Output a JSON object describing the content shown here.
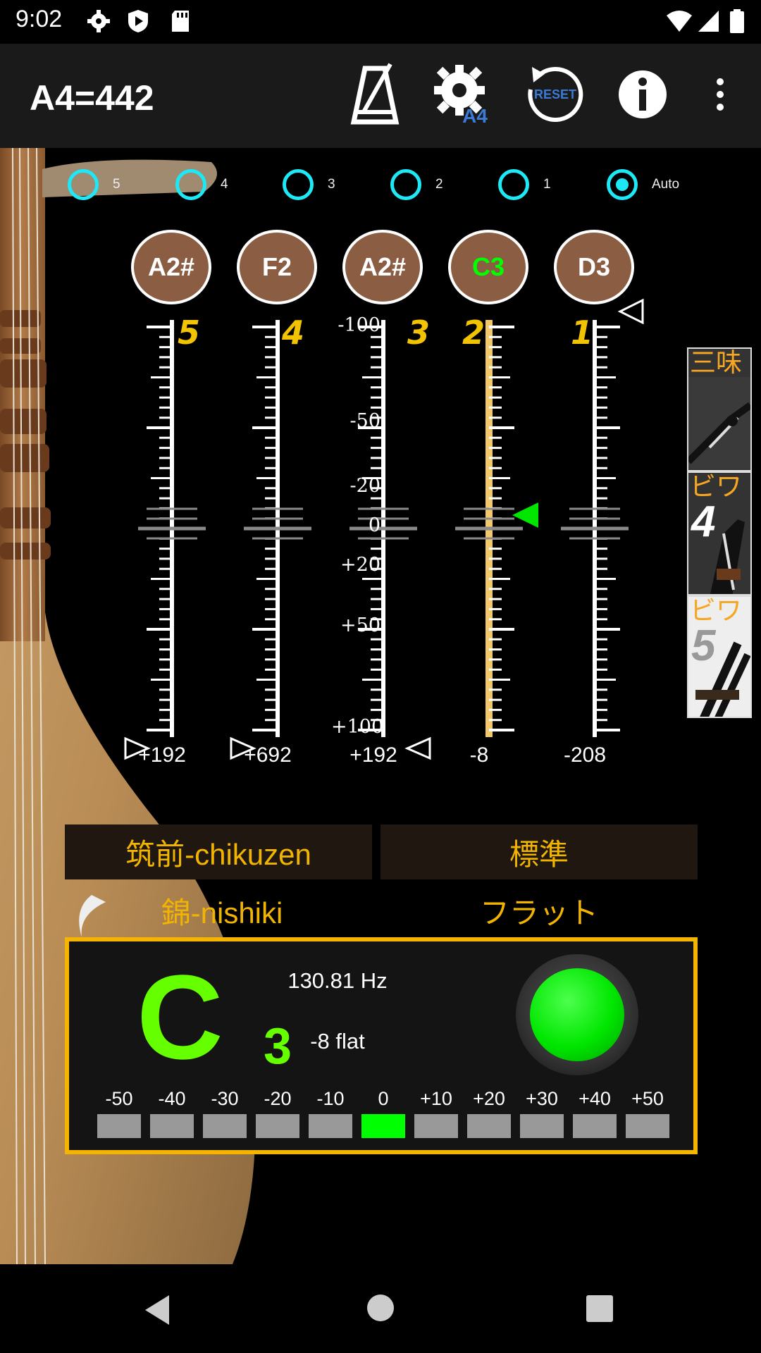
{
  "status_bar": {
    "time": "9:02"
  },
  "app_bar": {
    "title": "A4=442",
    "reset_label": "RESET",
    "a4_label": "A4"
  },
  "strings": {
    "options": [
      {
        "label": "5",
        "selected": false
      },
      {
        "label": "4",
        "selected": false
      },
      {
        "label": "3",
        "selected": false
      },
      {
        "label": "2",
        "selected": false
      },
      {
        "label": "1",
        "selected": false
      },
      {
        "label": "Auto",
        "selected": true
      }
    ],
    "notes": [
      {
        "name": "A2#",
        "string": "5",
        "cents": "+192",
        "active": false
      },
      {
        "name": "F2",
        "string": "4",
        "cents": "+692",
        "active": false
      },
      {
        "name": "A2#",
        "string": "3",
        "cents": "+192",
        "active": false
      },
      {
        "name": "C3",
        "string": "2",
        "cents": "-8",
        "active": true
      },
      {
        "name": "D3",
        "string": "1",
        "cents": "-208",
        "active": false
      }
    ]
  },
  "scale_labels": [
    "-100",
    "-50",
    "-20",
    "0",
    "+20",
    "+50",
    "+100"
  ],
  "side_tabs": [
    {
      "title": "三味",
      "numeral": ""
    },
    {
      "title": "ビワ",
      "numeral": "4"
    },
    {
      "title": "ビワ",
      "numeral": "5"
    }
  ],
  "presets": {
    "style_button": "筑前-chikuzen",
    "tuning_button": "標準",
    "style_value": "錦-nishiki",
    "tuning_value": "フラット"
  },
  "result": {
    "note": "C",
    "octave": "3",
    "frequency": "130.81 Hz",
    "deviation": "-8 flat",
    "meter_labels": [
      "-50",
      "-40",
      "-30",
      "-20",
      "-10",
      "0",
      "+10",
      "+20",
      "+30",
      "+40",
      "+50"
    ],
    "meter_active_index": 5
  },
  "colors": {
    "accent_cyan": "#1de9f6",
    "note_brown": "#8b5e44",
    "active_green": "#00ff00",
    "gold": "#f4b400"
  }
}
